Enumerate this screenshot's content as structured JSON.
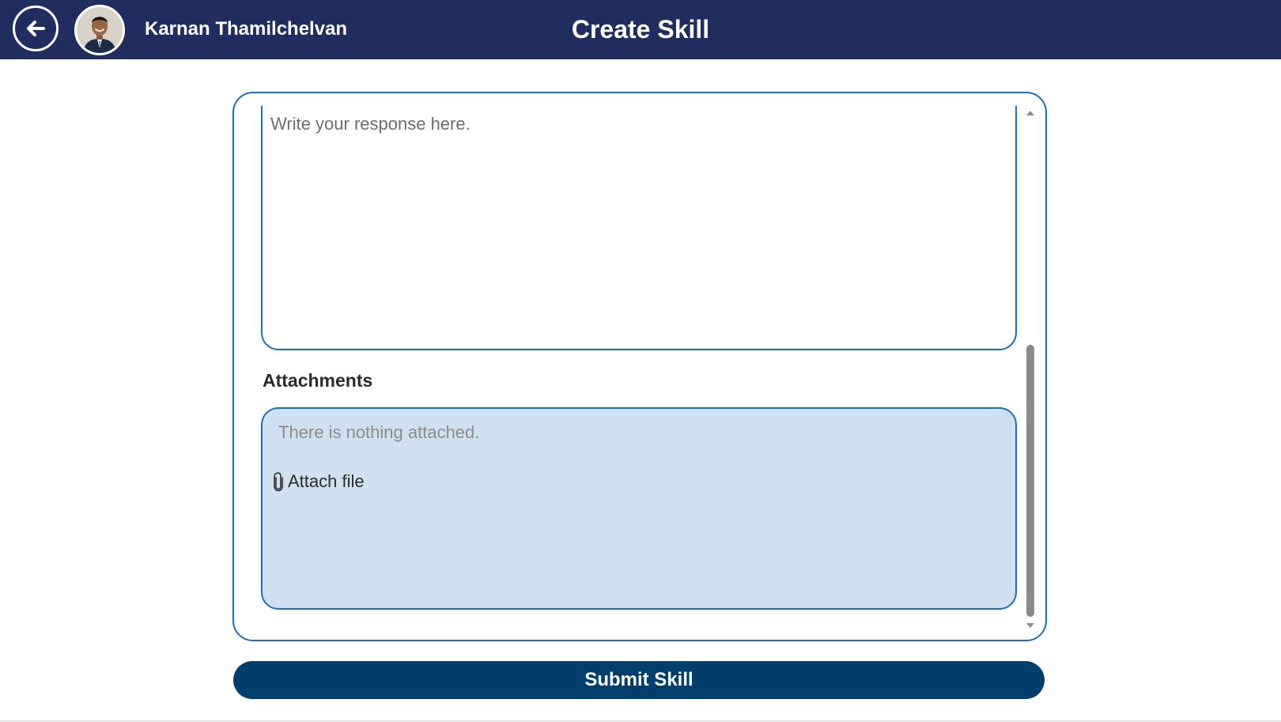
{
  "header": {
    "user_name": "Karnan Thamilchelvan",
    "title": "Create Skill",
    "back_icon": "arrow-left-icon",
    "background_color": "#1f2e5f"
  },
  "form": {
    "response_placeholder": "Write your response here.",
    "response_value": "",
    "attachments_label": "Attachments",
    "attachments_empty_message": "There is nothing attached.",
    "attach_file_label": "Attach file",
    "attach_icon": "paperclip-icon",
    "accent_color": "#1a6fbd",
    "attachments_bg_color": "#cfe1f0"
  },
  "submit": {
    "label": "Submit Skill",
    "color": "#003e6e"
  }
}
